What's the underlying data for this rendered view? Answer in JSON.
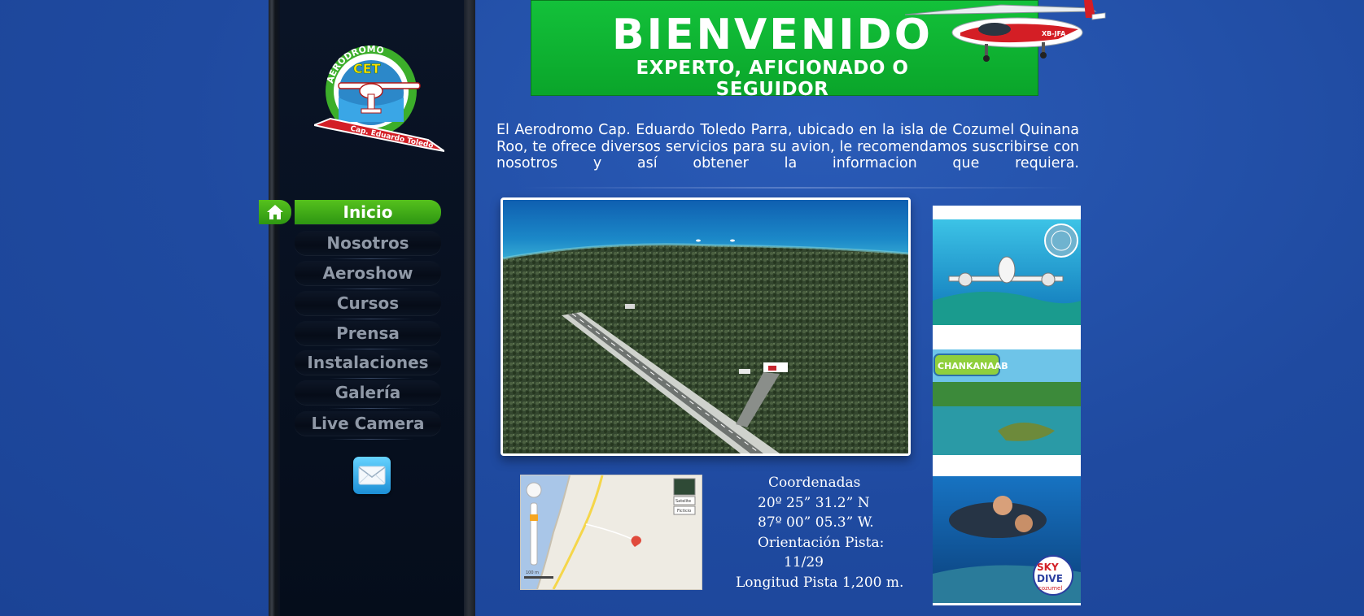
{
  "banner": {
    "title": "BIENVENIDO",
    "subtitle": "EXPERTO, AFICIONADO O SEGUIDOR"
  },
  "logo": {
    "arc_text": "AERODROMO",
    "center_text": "CET",
    "ribbon_text": "Cap. Eduardo Toledo"
  },
  "nav": {
    "items": [
      {
        "label": "Inicio",
        "active": true
      },
      {
        "label": "Nosotros",
        "active": false
      },
      {
        "label": "Aeroshow",
        "active": false
      },
      {
        "label": "Cursos",
        "active": false
      },
      {
        "label": "Prensa",
        "active": false
      },
      {
        "label": "Instalaciones",
        "active": false
      },
      {
        "label": "Galería",
        "active": false
      },
      {
        "label": "Live Camera",
        "active": false
      }
    ],
    "home_icon": "home-icon",
    "contact_icon": "envelope-icon"
  },
  "intro": {
    "text": "El Aerodromo Cap. Eduardo Toledo Parra, ubicado en la isla de Cozumel Quinana Roo, te ofrece diversos servicios para su avion, le recomendamos suscribirse con nosotros y así obtener la informacion que requiera."
  },
  "coords": {
    "heading": "Coordenadas",
    "lat": "20º 25” 31.2” N",
    "lon": "87º 00” 05.3” W.",
    "orientation_label": "Orientación Pista:",
    "orientation_value": "11/29",
    "length": "Longitud Pista 1,200 m."
  },
  "map": {
    "type_satellite": "Satelite",
    "type_other": "Ficticio"
  },
  "ads": {
    "chankanaab": "CHANKANAAB",
    "skydive_1": "SKY",
    "skydive_2": "DIVE",
    "skydive_3": "cozumel"
  },
  "colors": {
    "background": "#1f4aa0",
    "banner_green": "#13c13a",
    "nav_active": "#3fa916",
    "sidebar": "#050d1b"
  }
}
